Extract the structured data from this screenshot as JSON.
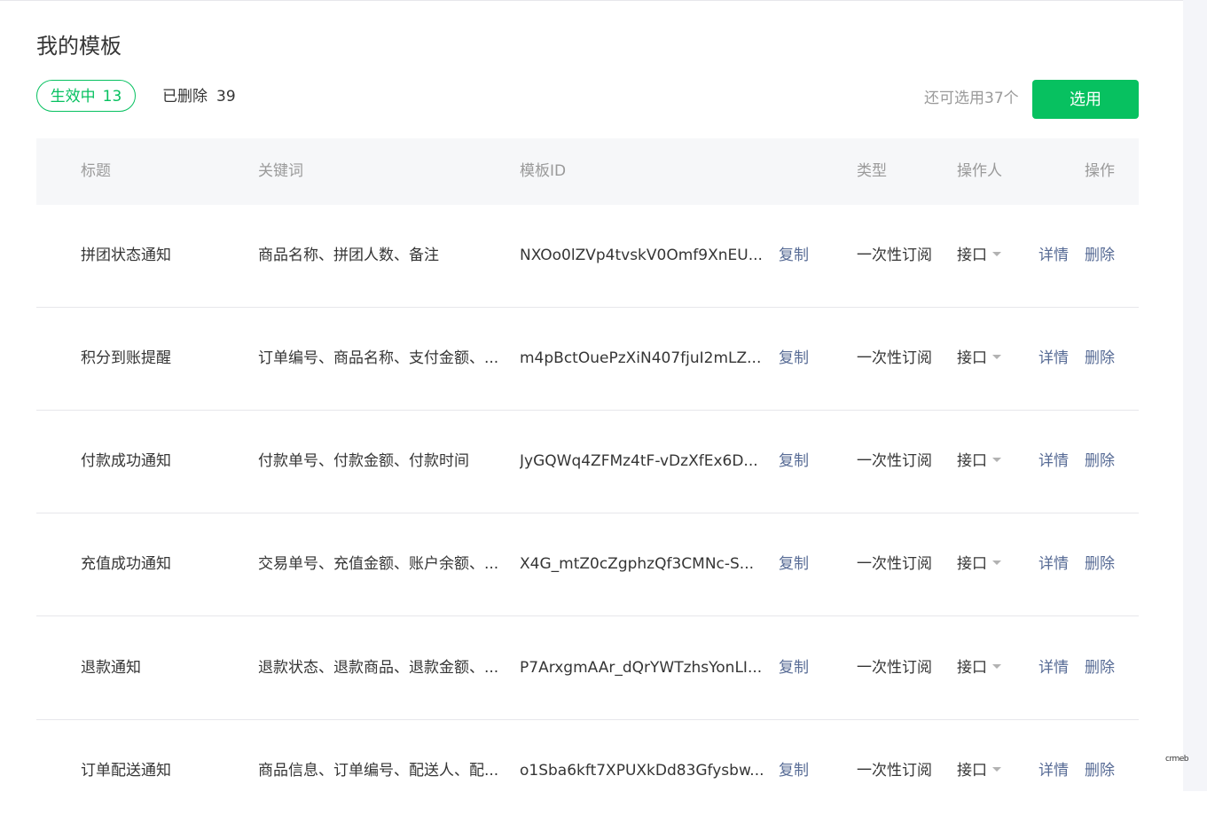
{
  "page_title": "我的模板",
  "tabs": {
    "active": {
      "label": "生效中",
      "count": "13"
    },
    "deleted": {
      "label": "已删除",
      "count": "39"
    }
  },
  "remaining_text": "还可选用37个",
  "select_button_label": "选用",
  "table": {
    "headers": {
      "title": "标题",
      "keywords": "关键词",
      "template_id": "模板ID",
      "type": "类型",
      "operator": "操作人",
      "actions": "操作"
    },
    "copy_label": "复制",
    "detail_label": "详情",
    "delete_label": "删除",
    "rows": [
      {
        "title": "拼团状态通知",
        "keywords": "商品名称、拼团人数、备注",
        "template_id": "NXOo0lZVp4tvskV0Omf9XnEU...",
        "type": "一次性订阅",
        "operator": "接口"
      },
      {
        "title": "积分到账提醒",
        "keywords": "订单编号、商品名称、支付金额、...",
        "template_id": "m4pBctOuePzXiN407fjuI2mLZ...",
        "type": "一次性订阅",
        "operator": "接口"
      },
      {
        "title": "付款成功通知",
        "keywords": "付款单号、付款金额、付款时间",
        "template_id": "JyGQWq4ZFMz4tF-vDzXfEx6D...",
        "type": "一次性订阅",
        "operator": "接口"
      },
      {
        "title": "充值成功通知",
        "keywords": "交易单号、充值金额、账户余额、...",
        "template_id": "X4G_mtZ0cZgphzQf3CMNc-S...",
        "type": "一次性订阅",
        "operator": "接口"
      },
      {
        "title": "退款通知",
        "keywords": "退款状态、退款商品、退款金额、...",
        "template_id": "P7ArxgmAAr_dQrYWTzhsYonLI...",
        "type": "一次性订阅",
        "operator": "接口"
      },
      {
        "title": "订单配送通知",
        "keywords": "商品信息、订单编号、配送人、配...",
        "template_id": "o1Sba6kft7XPUXkDd83Gfysbw...",
        "type": "一次性订阅",
        "operator": "接口"
      }
    ]
  },
  "watermark": "crmeb",
  "colors": {
    "accent": "#07c160",
    "link": "#576b95",
    "muted": "#9a9a9a",
    "text": "#353535"
  }
}
